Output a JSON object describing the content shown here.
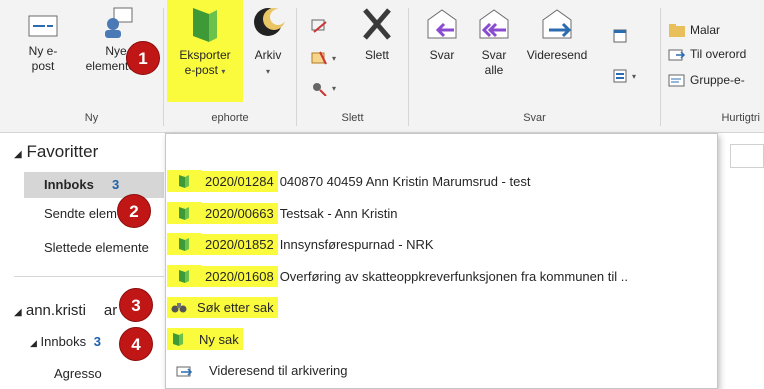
{
  "ribbon": {
    "new_email": [
      "Ny e-",
      "post"
    ],
    "new_items": [
      "Nye",
      "elementer"
    ],
    "export_email": [
      "Eksporter",
      "e-post"
    ],
    "archive": [
      "Arkiv"
    ],
    "delete": "Slett",
    "reply": "Svar",
    "reply_all": [
      "Svar",
      "alle"
    ],
    "forward": "Videresend",
    "quick_steps": [
      "Malar",
      "Til overord",
      "Gruppe-e-"
    ],
    "groups": [
      "Ny",
      "ephorte",
      "Slett",
      "Svar",
      "Hurtigtri"
    ]
  },
  "nav": {
    "favorites": "Favoritter",
    "inbox": "Innboks",
    "inbox_count": "3",
    "sent": "Sendte elem",
    "deleted": "Slettede elemente",
    "account": "ann.kristi",
    "account_suffix": "ar",
    "inbox2": "Innboks",
    "inbox2_count": "3",
    "agresso": "Agresso"
  },
  "menu": {
    "items": [
      {
        "code": "2020/01284",
        "text": "040870 40459 Ann Kristin Marumsrud - test"
      },
      {
        "code": "2020/00663",
        "text": "Testsak - Ann Kristin"
      },
      {
        "code": "2020/01852",
        "text": "Innsynsførespurnad - NRK"
      },
      {
        "code": "2020/01608",
        "text": "Overføring av skatteoppkreverfunksjonen fra kommunen til .."
      }
    ],
    "search_case": "Søk etter sak",
    "new_case": "Ny sak",
    "forward_archive": "Videresend til arkivering"
  },
  "badges": [
    "1",
    "2",
    "3",
    "4"
  ],
  "colors": {
    "highlight": "#fbfb3e",
    "badge": "#c01616",
    "accent": "#1e5fa8"
  }
}
